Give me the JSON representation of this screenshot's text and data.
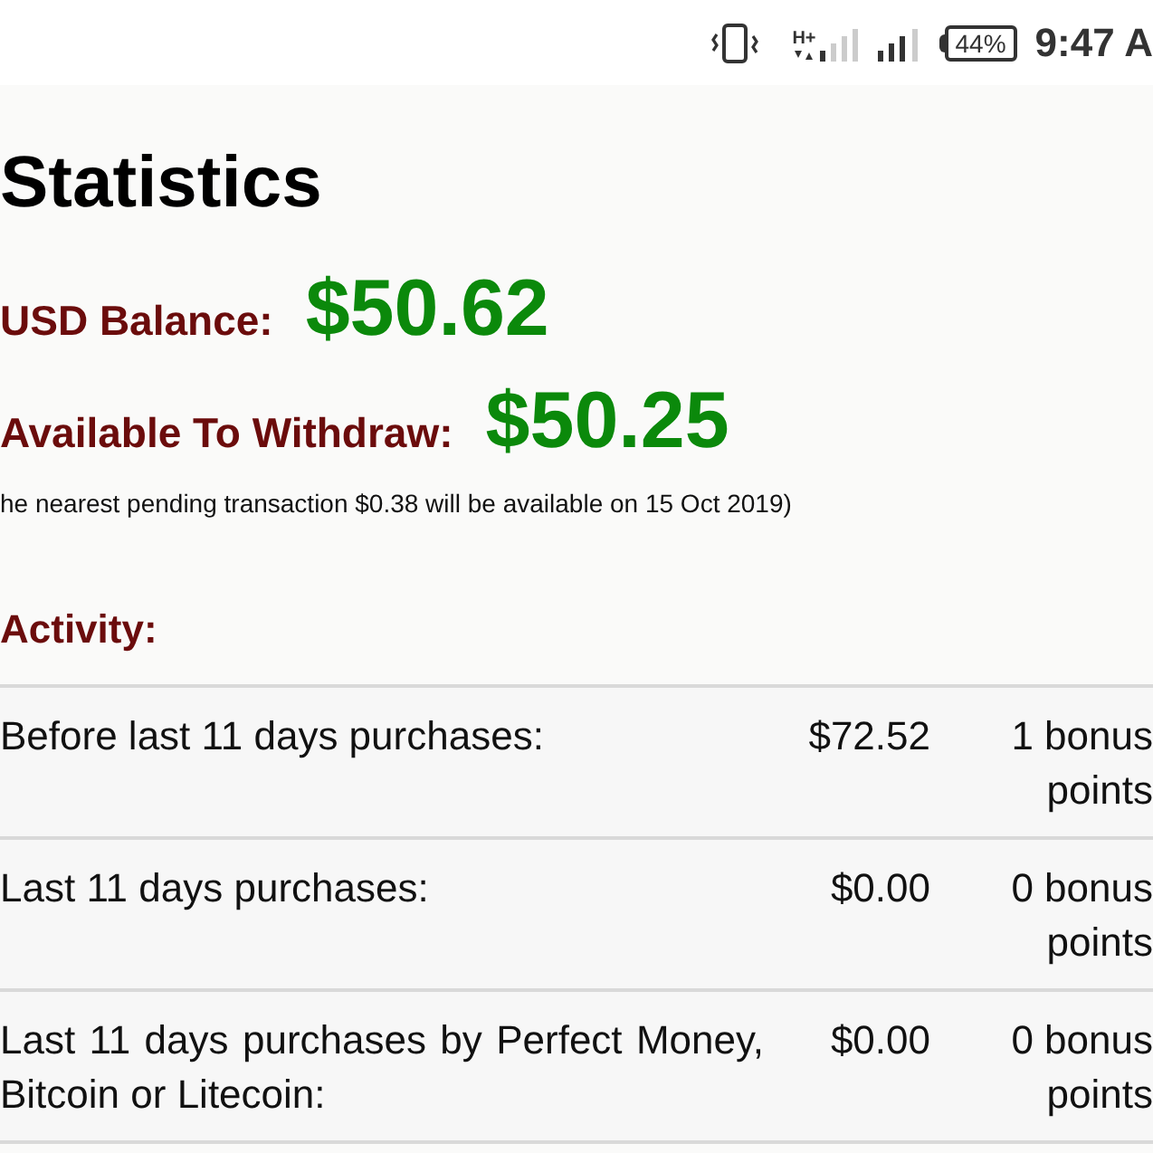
{
  "status_bar": {
    "network_type": "H+",
    "battery": "44%",
    "time": "9:47 A"
  },
  "page": {
    "title": "Statistics",
    "balances": [
      {
        "label": "USD Balance:",
        "amount": "$50.62"
      },
      {
        "label": "Available To Withdraw:",
        "amount": "$50.25"
      }
    ],
    "note": "he nearest pending transaction $0.38 will be available on 15 Oct 2019)",
    "activity": {
      "heading": "Activity:",
      "rows": [
        {
          "label": "Before last 11 days purchases:",
          "amount": "$72.52",
          "points": "1 bonus points"
        },
        {
          "label": "Last 11 days purchases:",
          "amount": "$0.00",
          "points": "0 bonus points"
        },
        {
          "label": "Last 11 days purchases by Perfect Money, Bitcoin or Litecoin:",
          "amount": "$0.00",
          "points": "0 bonus points"
        }
      ]
    }
  }
}
